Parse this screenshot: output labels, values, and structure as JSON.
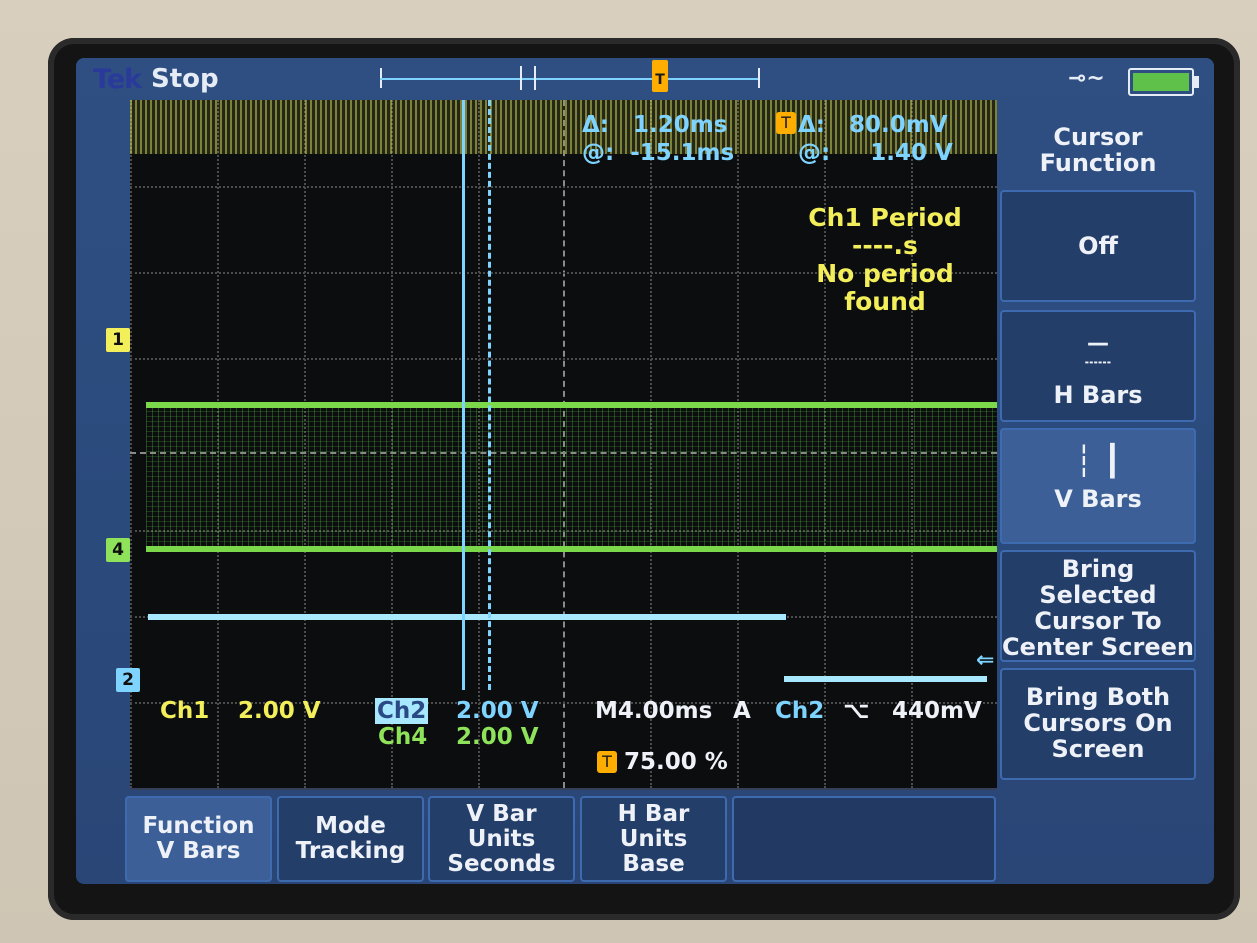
{
  "header": {
    "brand": "Tek",
    "run_state": "Stop"
  },
  "cursor_readout": {
    "delta_time": "Δ:   1.20ms",
    "at_time": "@:  -15.1ms",
    "delta_volt": "Δ:   80.0mV",
    "at_volt": "@:     1.40 V"
  },
  "measurement": {
    "line1": "Ch1 Period",
    "line2": "----.s",
    "line3": "No period",
    "line4": "found"
  },
  "channel_markers": {
    "ch1": "1",
    "ch4": "4",
    "ch2": "2"
  },
  "status": {
    "ch1_label": "Ch1",
    "ch1_scale": "2.00 V",
    "ch2_label": "Ch2",
    "ch2_scale": "2.00 V",
    "ch4_label": "Ch4",
    "ch4_scale": "2.00 V",
    "timebase": "M4.00ms",
    "trigger_mode": "A",
    "trigger_source": "Ch2",
    "trigger_slope": "⌥",
    "trigger_level": "440mV",
    "trigger_position": "75.00 %"
  },
  "side_menu": {
    "title_line1": "Cursor",
    "title_line2": "Function",
    "off": "Off",
    "h_bars": "H Bars",
    "v_bars": "V Bars",
    "bring_selected_1": "Bring",
    "bring_selected_2": "Selected",
    "bring_selected_3": "Cursor To",
    "bring_selected_4": "Center Screen",
    "bring_both_1": "Bring Both",
    "bring_both_2": "Cursors On",
    "bring_both_3": "Screen"
  },
  "bottom_menu": {
    "function_1": "Function",
    "function_2": "V Bars",
    "mode_1": "Mode",
    "mode_2": "Tracking",
    "vbar_1": "V Bar",
    "vbar_2": "Units",
    "vbar_3": "Seconds",
    "hbar_1": "H Bar",
    "hbar_2": "Units",
    "hbar_3": "Base"
  },
  "colors": {
    "ch1": "#f2ef5a",
    "ch2": "#7fd3ff",
    "ch4": "#8ee35a",
    "trigger": "#ffae00"
  }
}
